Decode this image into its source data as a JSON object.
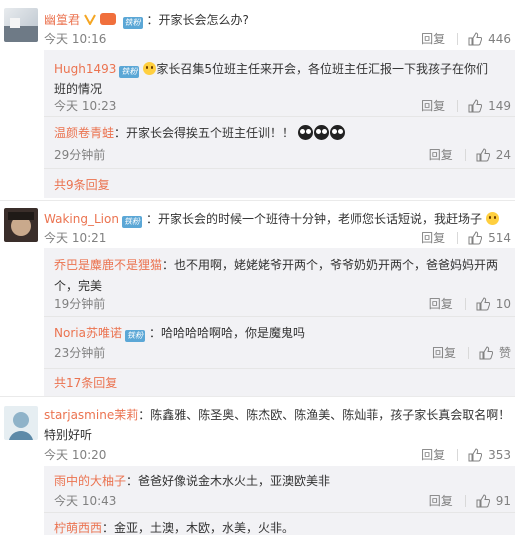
{
  "comments": [
    {
      "name": "幽篁君",
      "badge": "",
      "text": "：开家长会怎么办?",
      "time": "今天 10:16",
      "reply": "回复",
      "likes": "446",
      "subs": [
        {
          "name": "Hugh1493",
          "badge": "铁粉",
          "text1": "家长召集5位班主任来开会，各位班主任汇报一下我孩子在你们",
          "text2": "班的情况",
          "time": "今天 10:23",
          "reply": "回复",
          "likes": "149"
        },
        {
          "name": "温颜卷青蛙",
          "badge": "",
          "text1": "：开家长会得挨五个班主任训！！",
          "text2": "",
          "time": "29分钟前",
          "reply": "回复",
          "likes": "24"
        }
      ],
      "more": "共9条回复"
    },
    {
      "name": "Waking_Lion",
      "badge": "铁粉",
      "text": "：开家长会的时候一个班待十分钟，老师您长话短说，我赶场子",
      "time": "今天 10:21",
      "reply": "回复",
      "likes": "514",
      "subs": [
        {
          "name": "乔巴是麋鹿不是狸猫",
          "badge": "",
          "text1": "：也不用啊，姥姥姥爷开两个，爷爷奶奶开两个，爸爸妈妈开两",
          "text2": "个，完美",
          "time": "19分钟前",
          "reply": "回复",
          "likes": "10"
        },
        {
          "name": "Noria苏唯诺",
          "badge": "铁粉",
          "text1": "：哈哈哈哈啊哈，你是魔鬼吗",
          "text2": "",
          "time": "23分钟前",
          "reply": "回复",
          "likes": "赞"
        }
      ],
      "more": "共17条回复"
    },
    {
      "name": "starjasmine茉莉",
      "badge": "",
      "text": "：陈鑫雅、陈圣奥、陈杰欧、陈渔美、陈灿菲，孩子家长真会取名啊！",
      "text2": "特别好听",
      "time": "今天 10:20",
      "reply": "回复",
      "likes": "353",
      "subs": [
        {
          "name": "雨中的大柚子",
          "badge": "",
          "text1": "：爸爸好像说金木水火土，亚澳欧美非",
          "text2": "",
          "time": "今天 10:43",
          "reply": "回复",
          "likes": "91"
        },
        {
          "name": "柠萌西西",
          "badge": "",
          "text1": "：金亚，土澳，木欧，水美，火非。",
          "text2": "",
          "time": "",
          "reply": "",
          "likes": ""
        }
      ]
    }
  ],
  "colors": {
    "name": "#eb7350",
    "meta": "#808080",
    "subbg": "#f2f2f5",
    "badge": "#5ba7d6"
  }
}
